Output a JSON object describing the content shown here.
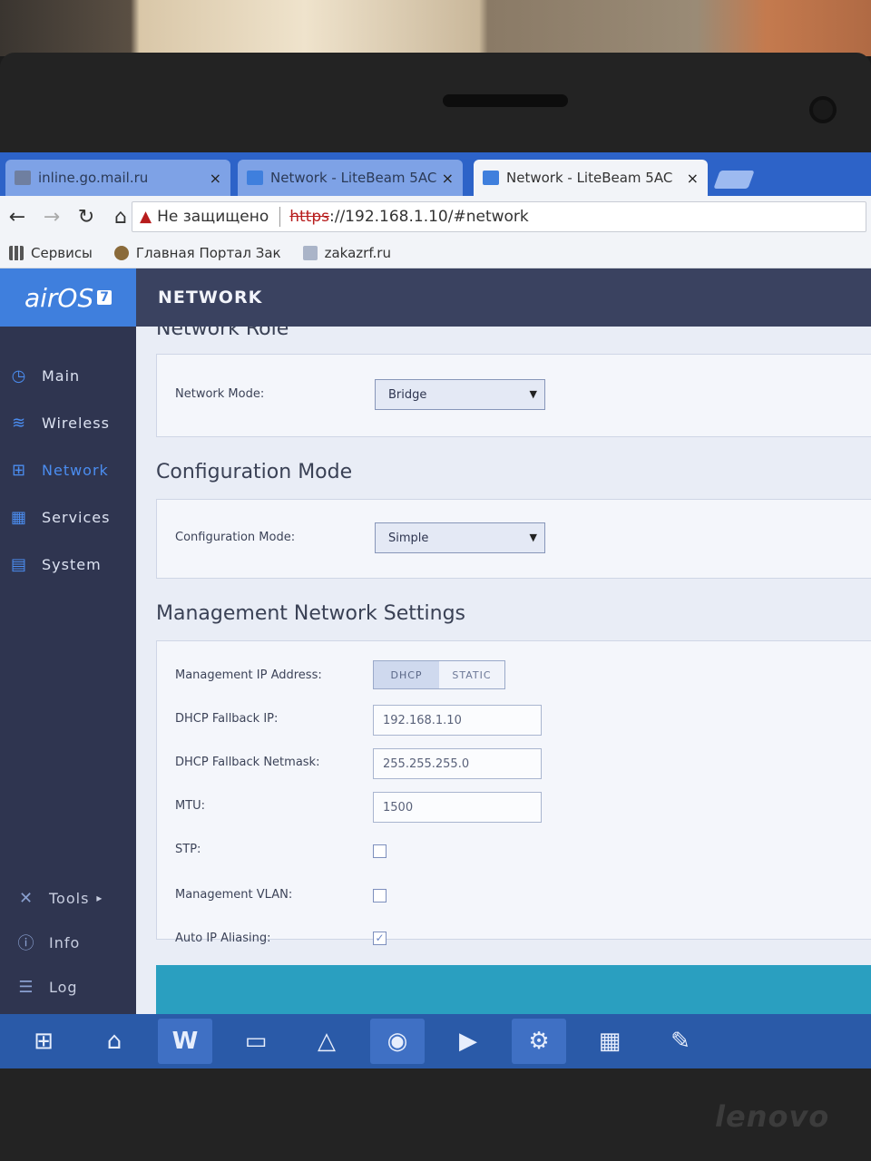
{
  "browser": {
    "tabs": [
      {
        "title": "inline.go.mail.ru",
        "close": "×"
      },
      {
        "title": "Network - LiteBeam 5AC",
        "close": "×"
      },
      {
        "title": "Network - LiteBeam 5AC",
        "close": "×"
      }
    ],
    "security_label": "Не защищено",
    "url_protocol": "https",
    "url_rest": "://192.168.1.10/#network",
    "bookmarks": [
      {
        "label": "Сервисы",
        "icon": "apps-grid-icon"
      },
      {
        "label": "Главная Портал Зак",
        "icon": "emblem-icon"
      },
      {
        "label": "zakazrf.ru",
        "icon": "page-icon"
      }
    ]
  },
  "app": {
    "logo": "airOS",
    "logo_version": "7",
    "header_title": "NETWORK",
    "sidebar": {
      "items": [
        {
          "label": "Main",
          "icon": "dashboard-icon",
          "glyph": "◷"
        },
        {
          "label": "Wireless",
          "icon": "wifi-icon",
          "glyph": "≋"
        },
        {
          "label": "Network",
          "icon": "network-icon",
          "glyph": "⊞"
        },
        {
          "label": "Services",
          "icon": "services-icon",
          "glyph": "▦"
        },
        {
          "label": "System",
          "icon": "system-icon",
          "glyph": "▤"
        }
      ],
      "lower_items": [
        {
          "label": "Tools",
          "icon": "tools-icon",
          "glyph": "✕",
          "arrow": "▸"
        },
        {
          "label": "Info",
          "icon": "info-icon",
          "glyph": "ⓘ"
        },
        {
          "label": "Log",
          "icon": "log-icon",
          "glyph": "☰"
        }
      ]
    },
    "sections": {
      "network_role": {
        "title": "Network Role",
        "network_mode_label": "Network Mode:",
        "network_mode_value": "Bridge"
      },
      "configuration_mode": {
        "title": "Configuration Mode",
        "label": "Configuration Mode:",
        "value": "Simple"
      },
      "management": {
        "title": "Management Network Settings",
        "ip_address_label": "Management IP Address:",
        "ip_mode_options": [
          "DHCP",
          "STATIC"
        ],
        "ip_mode_selected": "DHCP",
        "fallback_ip_label": "DHCP Fallback IP:",
        "fallback_ip_value": "192.168.1.10",
        "fallback_netmask_label": "DHCP Fallback Netmask:",
        "fallback_netmask_value": "255.255.255.0",
        "mtu_label": "MTU:",
        "mtu_value": "1500",
        "stp_label": "STP:",
        "stp_checked": false,
        "vlan_label": "Management VLAN:",
        "vlan_checked": false,
        "alias_label": "Auto IP Aliasing:",
        "alias_checked": true
      }
    }
  },
  "taskbar": {
    "items": [
      "windows-start-icon",
      "home-icon",
      "word-icon",
      "scanner-icon",
      "app-triangle-icon",
      "chrome-icon",
      "media-icon",
      "settings-gear-icon",
      "network-manager-icon",
      "paint-icon"
    ]
  },
  "device_brand": "lenovo"
}
